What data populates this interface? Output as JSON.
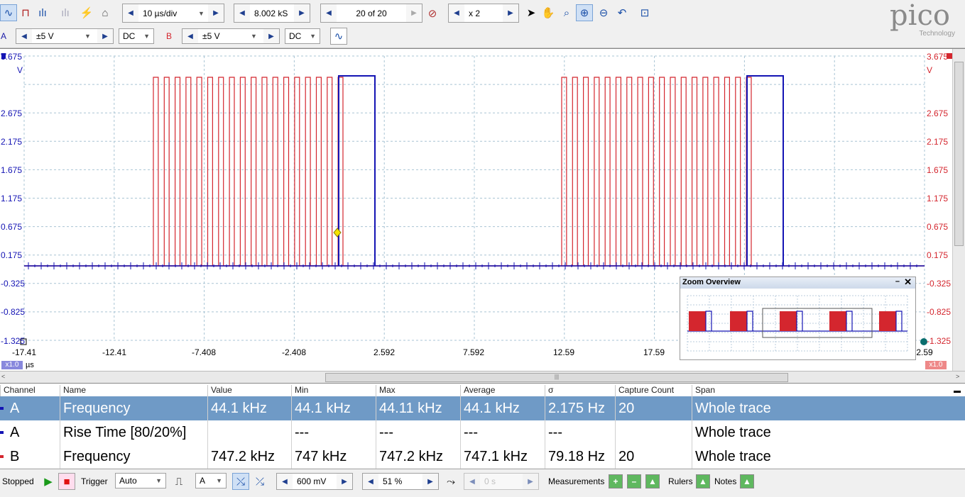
{
  "toolbar": {
    "timebase": "10 µs/div",
    "samples": "8.002 kS",
    "buffer": "20 of 20",
    "zoom_factor": "x 2",
    "logo_text": "pico",
    "logo_sub": "Technology"
  },
  "channels": {
    "a_label": "A",
    "a_range": "±5 V",
    "a_coupling": "DC",
    "b_label": "B",
    "b_range": "±5 V",
    "b_coupling": "DC"
  },
  "scope": {
    "y_ticks": [
      "3.675",
      "2.675",
      "2.175",
      "1.675",
      "1.175",
      "0.675",
      "0.175",
      "-0.325",
      "-0.825",
      "-1.325"
    ],
    "y_unit_left": "V",
    "y_unit_right": "V",
    "x_ticks": [
      "-17.41",
      "-12.41",
      "-7.408",
      "-2.408",
      "2.592",
      "7.592",
      "12.59",
      "17.59",
      "2.59"
    ],
    "x_unit": "µs",
    "x_zoom_left": "x1.0",
    "x_zoom_right": "x1.0",
    "colors": {
      "channel_a": "#1414b4",
      "channel_b": "#d4262e",
      "grid": "#a9c4d4"
    }
  },
  "zoom_overview": {
    "title": "Zoom Overview"
  },
  "measurements": {
    "headers": [
      "Channel",
      "Name",
      "Value",
      "Min",
      "Max",
      "Average",
      "σ",
      "Capture Count",
      "Span"
    ],
    "rows": [
      {
        "channel": "A",
        "name": "Frequency",
        "value": "44.1 kHz",
        "min": "44.1 kHz",
        "max": "44.11 kHz",
        "avg": "44.1 kHz",
        "sigma": "2.175 Hz",
        "count": "20",
        "span": "Whole trace"
      },
      {
        "channel": "A",
        "name": "Rise Time  [80/20%]",
        "value": "",
        "min": "---",
        "max": "---",
        "avg": "---",
        "sigma": "---",
        "count": "",
        "span": "Whole trace"
      },
      {
        "channel": "B",
        "name": "Frequency",
        "value": "747.2 kHz",
        "min": "747 kHz",
        "max": "747.2 kHz",
        "avg": "747.1 kHz",
        "sigma": "79.18 Hz",
        "count": "20",
        "span": "Whole trace"
      }
    ]
  },
  "status": {
    "state": "Stopped",
    "trigger_label": "Trigger",
    "trigger_mode": "Auto",
    "trigger_channel": "A",
    "threshold": "600 mV",
    "pretrigger": "51 %",
    "delay": "0 s",
    "measurements_label": "Measurements",
    "rulers_label": "Rulers",
    "notes_label": "Notes"
  }
}
